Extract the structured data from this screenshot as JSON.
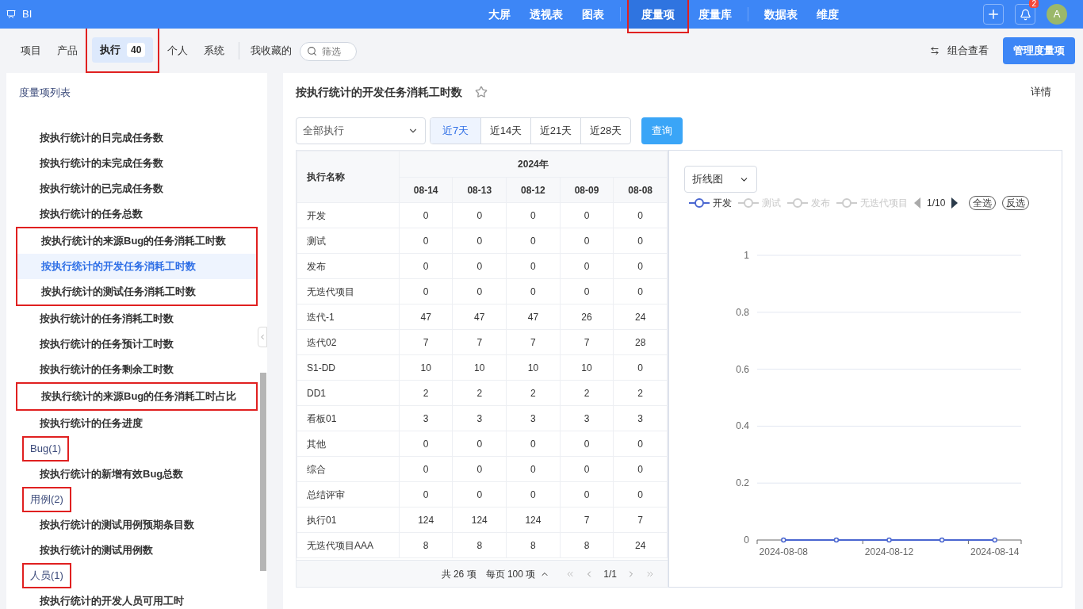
{
  "app": {
    "name": "BI"
  },
  "nav": {
    "groups": [
      [
        {
          "label": "大屏",
          "selected": false,
          "annotated": false
        },
        {
          "label": "透视表",
          "selected": false,
          "annotated": false
        },
        {
          "label": "图表",
          "selected": false,
          "annotated": false
        }
      ],
      [
        {
          "label": "度量项",
          "selected": true,
          "annotated": true
        },
        {
          "label": "度量库",
          "selected": false,
          "annotated": false
        }
      ],
      [
        {
          "label": "数据表",
          "selected": false,
          "annotated": false
        },
        {
          "label": "维度",
          "selected": false,
          "annotated": false
        }
      ]
    ],
    "notification_count": "2",
    "avatar": "A"
  },
  "scope_tabs": [
    {
      "label": "项目",
      "selected": false,
      "annotated": false
    },
    {
      "label": "产品",
      "selected": false,
      "annotated": false
    },
    {
      "label": "执行",
      "count": "40",
      "selected": true,
      "annotated": true
    },
    {
      "label": "个人",
      "selected": false,
      "annotated": false
    },
    {
      "label": "系统",
      "selected": false,
      "annotated": false
    }
  ],
  "favorites": "我收藏的",
  "filter": {
    "placeholder": "筛选"
  },
  "combine_view": "组合查看",
  "manage_button": "管理度量项",
  "sidebar": {
    "title": "度量项列表",
    "items": [
      {
        "kind": "item",
        "label": "按执行统计的日完成任务数",
        "selected": false,
        "annotated": false
      },
      {
        "kind": "item",
        "label": "按执行统计的未完成任务数",
        "selected": false,
        "annotated": false
      },
      {
        "kind": "item",
        "label": "按执行统计的已完成任务数",
        "selected": false,
        "annotated": false
      },
      {
        "kind": "item",
        "label": "按执行统计的任务总数",
        "selected": false,
        "annotated": false
      },
      {
        "kind": "item",
        "label": "按执行统计的来源Bug的任务消耗工时数",
        "selected": false,
        "annotated": true
      },
      {
        "kind": "item",
        "label": "按执行统计的开发任务消耗工时数",
        "selected": true,
        "annotated": true
      },
      {
        "kind": "item",
        "label": "按执行统计的测试任务消耗工时数",
        "selected": false,
        "annotated": true
      },
      {
        "kind": "item",
        "label": "按执行统计的任务消耗工时数",
        "selected": false,
        "annotated": false
      },
      {
        "kind": "item",
        "label": "按执行统计的任务预计工时数",
        "selected": false,
        "annotated": false
      },
      {
        "kind": "item",
        "label": "按执行统计的任务剩余工时数",
        "selected": false,
        "annotated": false
      },
      {
        "kind": "item",
        "label": "按执行统计的来源Bug的任务消耗工时占比",
        "selected": false,
        "annotated": true
      },
      {
        "kind": "item",
        "label": "按执行统计的任务进度",
        "selected": false,
        "annotated": false
      },
      {
        "kind": "heading",
        "label": "Bug(1)",
        "annotated": true
      },
      {
        "kind": "item",
        "label": "按执行统计的新增有效Bug总数",
        "selected": false,
        "annotated": false
      },
      {
        "kind": "heading",
        "label": "用例(2)",
        "annotated": true
      },
      {
        "kind": "item",
        "label": "按执行统计的测试用例预期条目数",
        "selected": false,
        "annotated": false
      },
      {
        "kind": "item",
        "label": "按执行统计的测试用例数",
        "selected": false,
        "annotated": false
      },
      {
        "kind": "heading",
        "label": "人员(1)",
        "annotated": true
      },
      {
        "kind": "item",
        "label": "按执行统计的开发人员可用工时",
        "selected": false,
        "annotated": false
      }
    ]
  },
  "metric": {
    "title": "按执行统计的开发任务消耗工时数",
    "starred": false,
    "details": "详情"
  },
  "scope_select": {
    "value": "全部执行"
  },
  "ranges": [
    {
      "label": "近7天",
      "selected": true
    },
    {
      "label": "近14天",
      "selected": false
    },
    {
      "label": "近21天",
      "selected": false
    },
    {
      "label": "近28天",
      "selected": false
    }
  ],
  "query_button": "查询",
  "table": {
    "name_column": "执行名称",
    "year": "2024年",
    "dates": [
      "08-14",
      "08-13",
      "08-12",
      "08-09",
      "08-08"
    ],
    "rows": [
      {
        "name": "开发",
        "values": [
          "0",
          "0",
          "0",
          "0",
          "0"
        ]
      },
      {
        "name": "测试",
        "values": [
          "0",
          "0",
          "0",
          "0",
          "0"
        ]
      },
      {
        "name": "发布",
        "values": [
          "0",
          "0",
          "0",
          "0",
          "0"
        ]
      },
      {
        "name": "无迭代项目",
        "values": [
          "0",
          "0",
          "0",
          "0",
          "0"
        ]
      },
      {
        "name": "迭代-1",
        "values": [
          "47",
          "47",
          "47",
          "26",
          "24"
        ]
      },
      {
        "name": "迭代02",
        "values": [
          "7",
          "7",
          "7",
          "7",
          "28"
        ]
      },
      {
        "name": "S1-DD",
        "values": [
          "10",
          "10",
          "10",
          "10",
          "0"
        ]
      },
      {
        "name": "DD1",
        "values": [
          "2",
          "2",
          "2",
          "2",
          "2"
        ]
      },
      {
        "name": "看板01",
        "values": [
          "3",
          "3",
          "3",
          "3",
          "3"
        ]
      },
      {
        "name": "其他",
        "values": [
          "0",
          "0",
          "0",
          "0",
          "0"
        ]
      },
      {
        "name": "综合",
        "values": [
          "0",
          "0",
          "0",
          "0",
          "0"
        ]
      },
      {
        "name": "总结评审",
        "values": [
          "0",
          "0",
          "0",
          "0",
          "0"
        ]
      },
      {
        "name": "执行01",
        "values": [
          "124",
          "124",
          "124",
          "7",
          "7"
        ]
      },
      {
        "name": "无迭代项目AAA",
        "values": [
          "8",
          "8",
          "8",
          "8",
          "24"
        ]
      }
    ],
    "total": "共 26 项",
    "page_size": "每页 100 项",
    "page": "1/1"
  },
  "chart": {
    "type_select": "折线图",
    "legend": [
      {
        "selected": true
      },
      {
        "label": "测试",
        "selected": false
      },
      {
        "label": "发布",
        "selected": false
      },
      {
        "label": "无迭代项目",
        "selected": false
      }
    ],
    "legend_page": "1/10",
    "select_all": "全选",
    "invert": "反选",
    "chart_data": {
      "type": "line",
      "grid": true,
      "categories": [
        "2024-08-08",
        null,
        "2024-08-12",
        null,
        "2024-08-14"
      ],
      "series": [
        {
          "name": "开发",
          "color": "#4a66d0",
          "marker": "circle",
          "values": [
            0,
            0,
            0,
            0,
            0
          ]
        }
      ],
      "ylim": [
        0,
        1
      ],
      "yticks": [
        0,
        0.2,
        0.4,
        0.6,
        0.8,
        1
      ]
    }
  }
}
